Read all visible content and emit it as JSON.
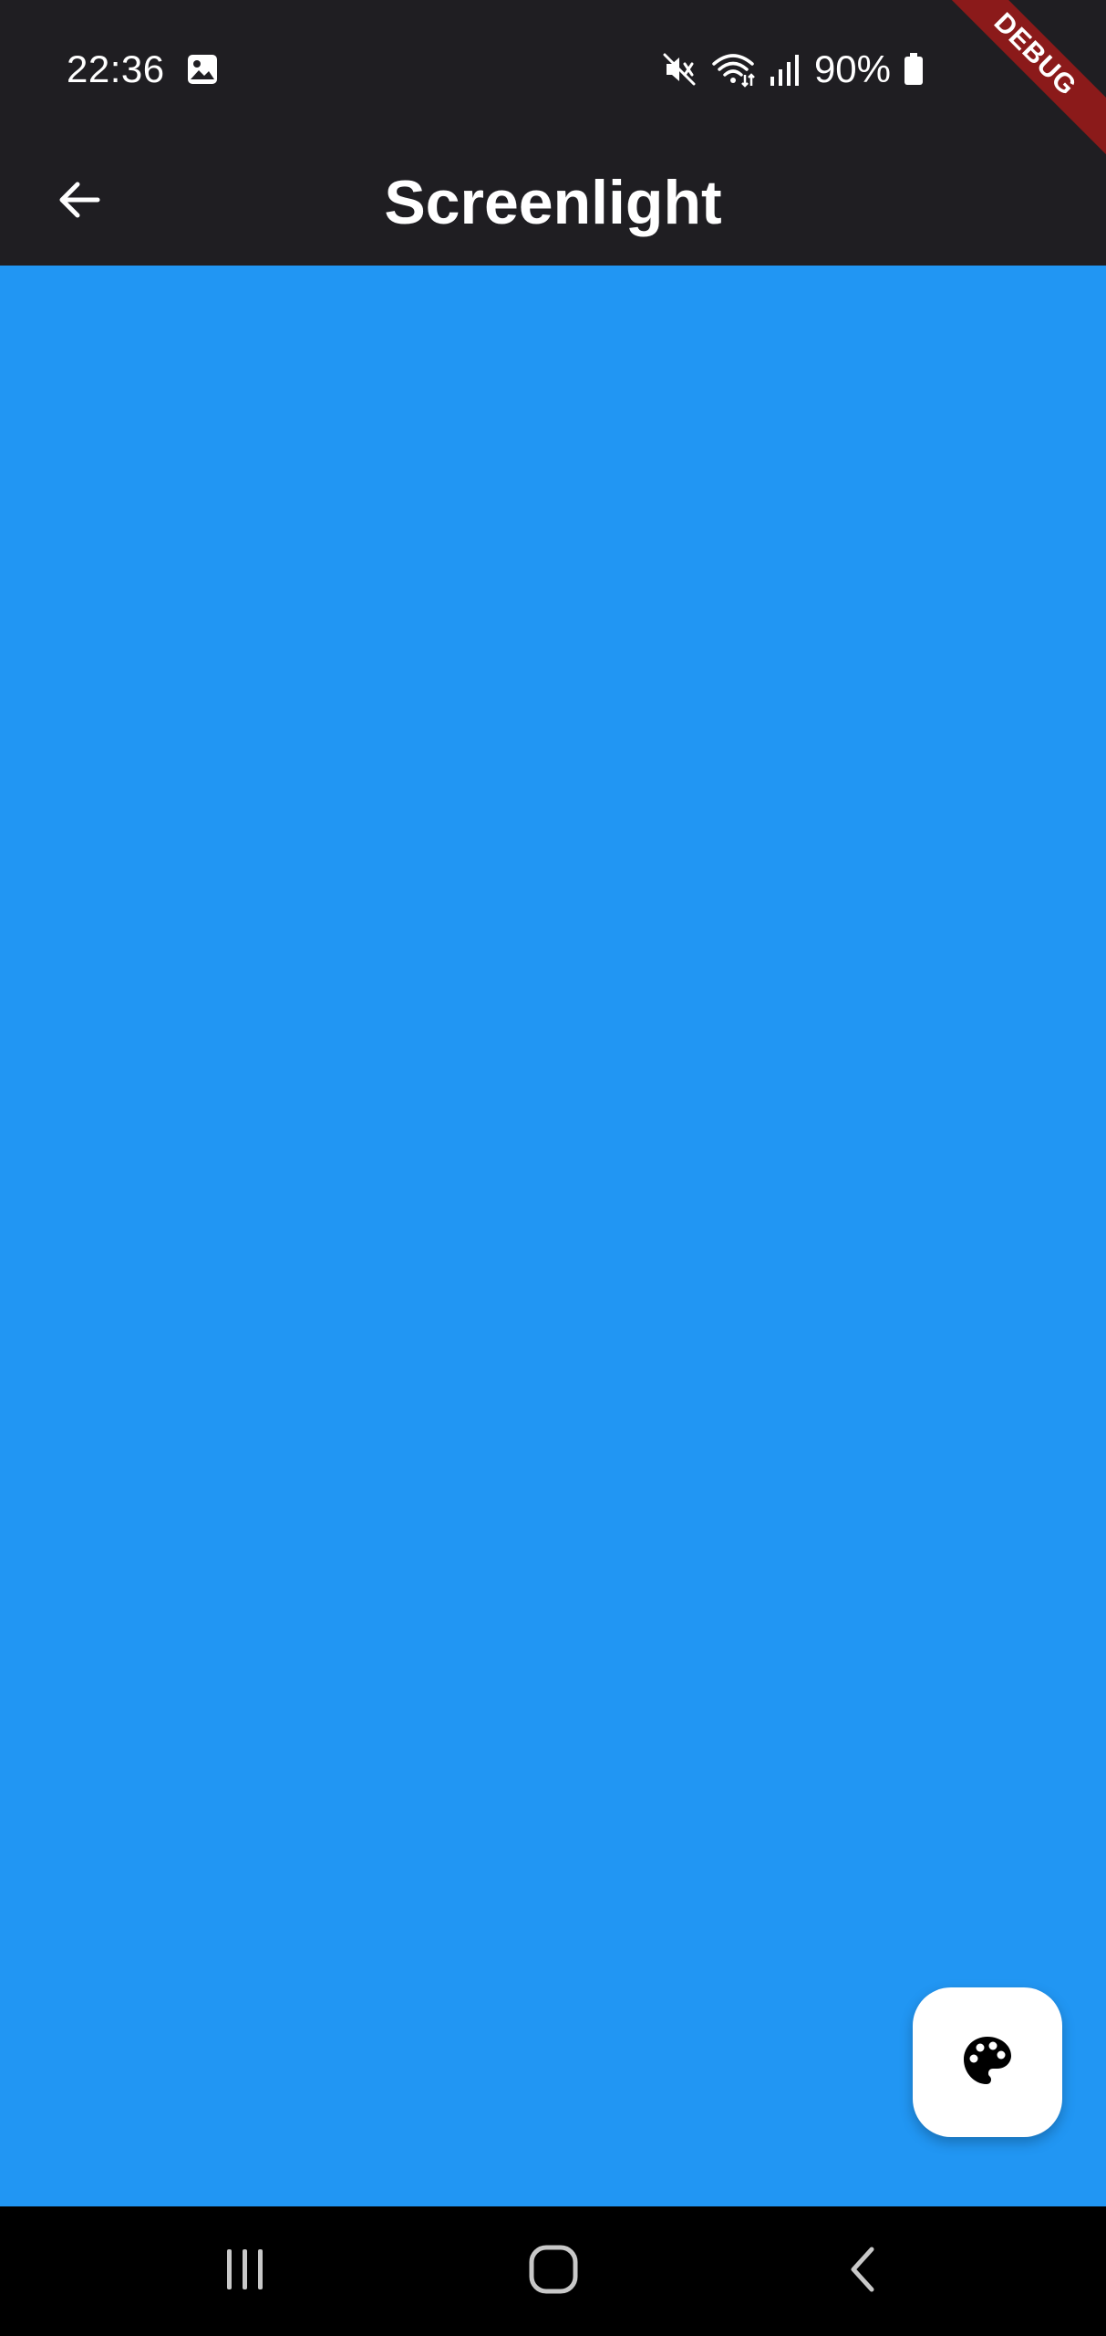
{
  "status_bar": {
    "time": "22:36",
    "battery_percent": "90%",
    "icons": [
      "gallery-icon",
      "mute-icon",
      "wifi-icon",
      "signal-icon",
      "battery-icon"
    ]
  },
  "app_bar": {
    "title": "Screenlight",
    "back_icon": "arrow-back-icon"
  },
  "debug_banner": {
    "label": "DEBUG"
  },
  "content": {
    "background_color": "#2196f3"
  },
  "fab": {
    "icon": "palette-icon"
  },
  "nav_bar": {
    "icons": [
      "recents-icon",
      "home-icon",
      "back-icon"
    ]
  }
}
